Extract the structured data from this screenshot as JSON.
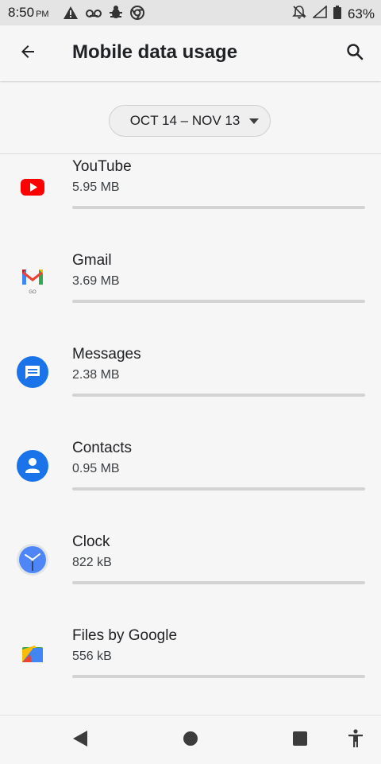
{
  "status_bar": {
    "time": "8:50",
    "ampm": "PM",
    "battery": "63%",
    "left_icons": [
      "warning-icon",
      "voicemail-icon",
      "bug-icon",
      "chrome-icon"
    ],
    "right_icons": [
      "notifications-off-icon",
      "signal-icon",
      "battery-icon"
    ]
  },
  "appbar": {
    "title": "Mobile data usage",
    "back_icon": "arrow-back-icon",
    "search_icon": "search-icon"
  },
  "date_range": {
    "label": "OCT 14 – NOV 13",
    "caret_icon": "dropdown-caret-icon"
  },
  "apps": [
    {
      "name": "YouTube",
      "usage": "5.95 MB",
      "icon": "youtube-icon",
      "icon_text": ""
    },
    {
      "name": "Gmail",
      "usage": "3.69 MB",
      "icon": "gmail-icon",
      "icon_text": "GO"
    },
    {
      "name": "Messages",
      "usage": "2.38 MB",
      "icon": "messages-icon",
      "icon_text": ""
    },
    {
      "name": "Contacts",
      "usage": "0.95 MB",
      "icon": "contacts-icon",
      "icon_text": ""
    },
    {
      "name": "Clock",
      "usage": "822 kB",
      "icon": "clock-icon",
      "icon_text": ""
    },
    {
      "name": "Files by Google",
      "usage": "556 kB",
      "icon": "files-icon",
      "icon_text": ""
    }
  ],
  "nav_bar": {
    "buttons": [
      "back-triangle-icon",
      "home-circle-icon",
      "recents-square-icon",
      "accessibility-icon"
    ]
  },
  "colors": {
    "accent": "#1a73e8",
    "youtube_red": "#ff0000",
    "bar_track": "#d3d3d3",
    "status_bar_bg": "#e4e4e4"
  }
}
